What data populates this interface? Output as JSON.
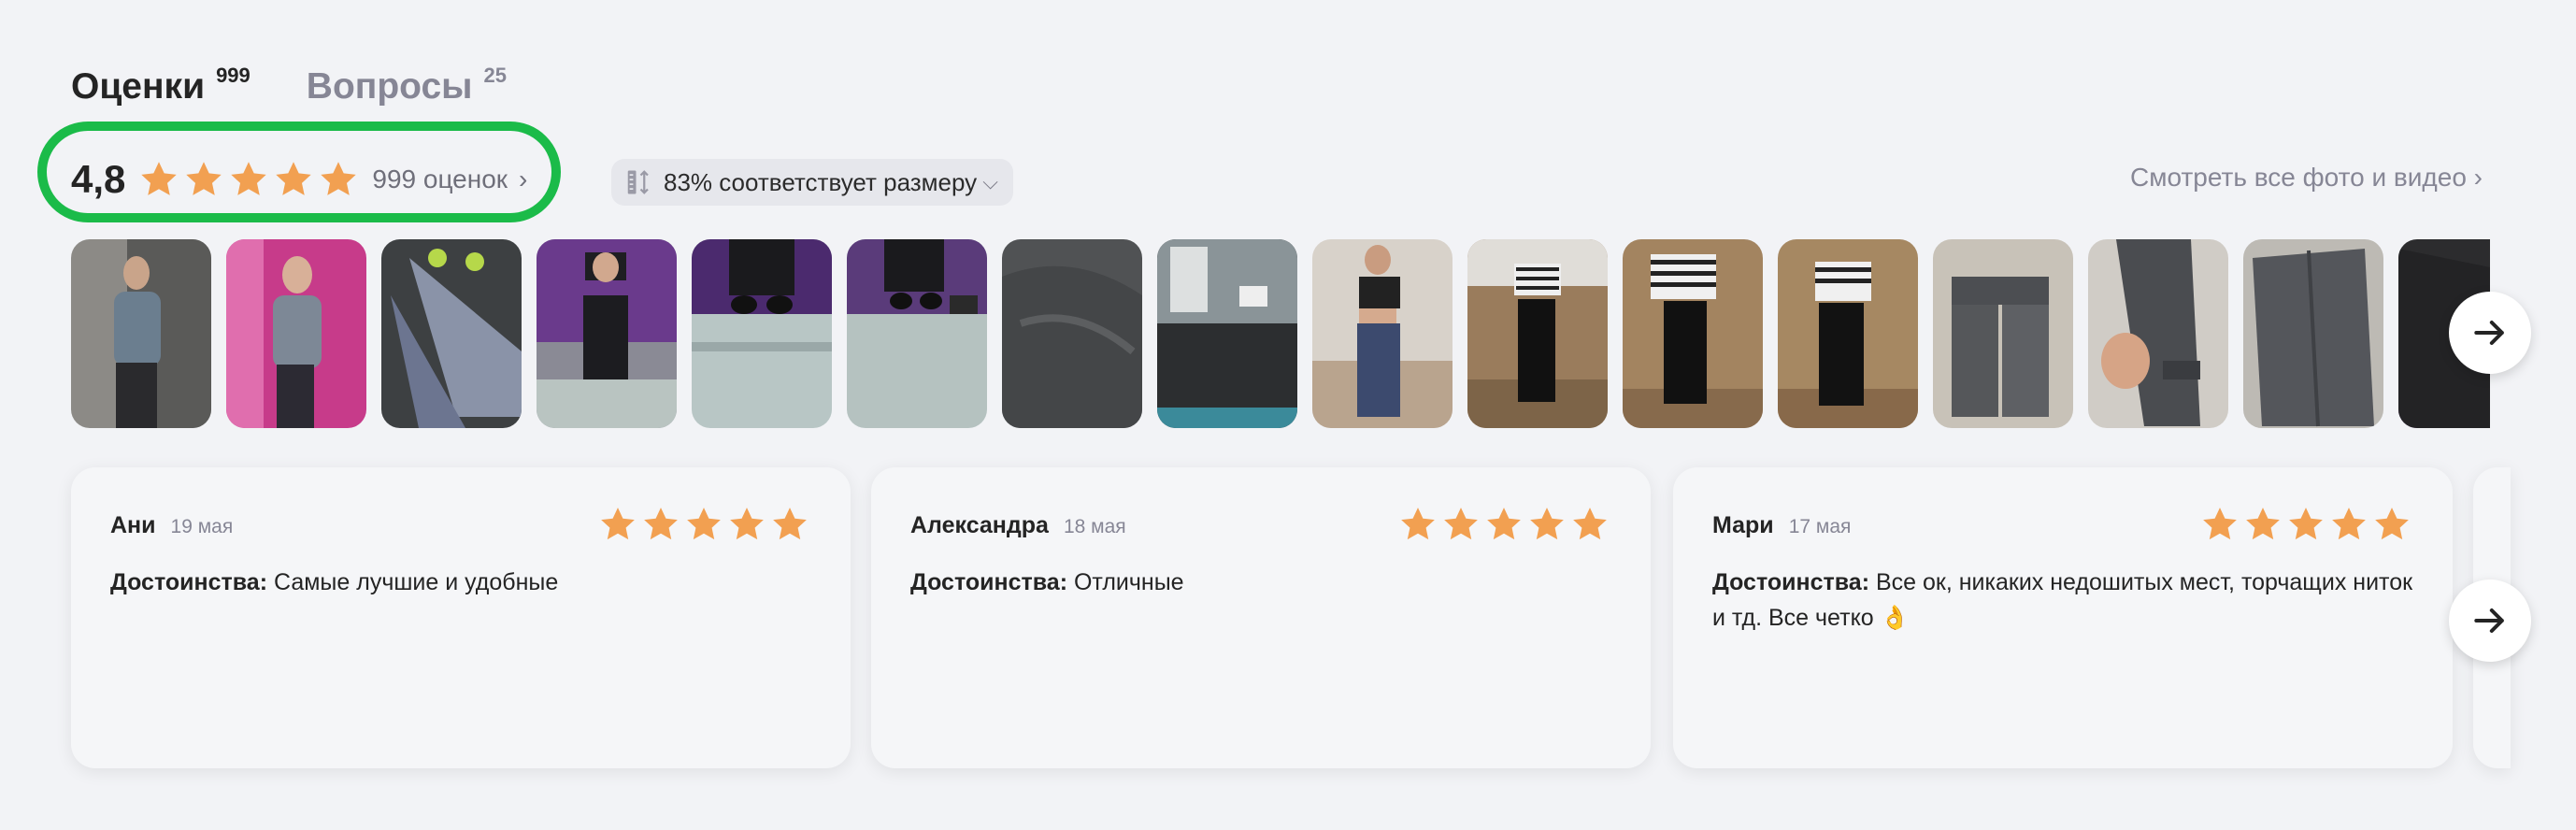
{
  "tabs": [
    {
      "label": "Оценки",
      "count": "999"
    },
    {
      "label": "Вопросы",
      "count": "25"
    }
  ],
  "rating": {
    "value": "4,8",
    "stars": 5,
    "count_label": "999 оценок",
    "chevron": "›"
  },
  "size_fit": {
    "label": "83% соответствует размеру",
    "chevron": "⌵"
  },
  "see_all": "Смотреть все фото и видео ›",
  "photos": [
    "photo-1",
    "photo-2",
    "photo-3",
    "photo-4",
    "photo-5",
    "photo-6",
    "photo-7",
    "photo-8",
    "photo-9",
    "photo-10",
    "photo-11",
    "photo-12",
    "photo-13",
    "photo-14",
    "photo-15",
    "photo-16"
  ],
  "reviews": [
    {
      "name": "Ани",
      "date": "19 мая",
      "stars": 5,
      "label": "Достоинства:",
      "text": "Самые лучшие и удобные"
    },
    {
      "name": "Александра",
      "date": "18 мая",
      "stars": 5,
      "label": "Достоинства:",
      "text": "Отличные"
    },
    {
      "name": "Мари",
      "date": "17 мая",
      "stars": 5,
      "label": "Достоинства:",
      "text": "Все ок, никаких недошитых мест, торчащих ниток и тд. Все четко 👌"
    }
  ],
  "colors": {
    "star": "#f2a051",
    "highlight": "#1bbb49",
    "muted": "#868695"
  },
  "icons": [
    "star-icon",
    "ruler-icon",
    "arrow-right-icon",
    "chevron-right-icon"
  ]
}
